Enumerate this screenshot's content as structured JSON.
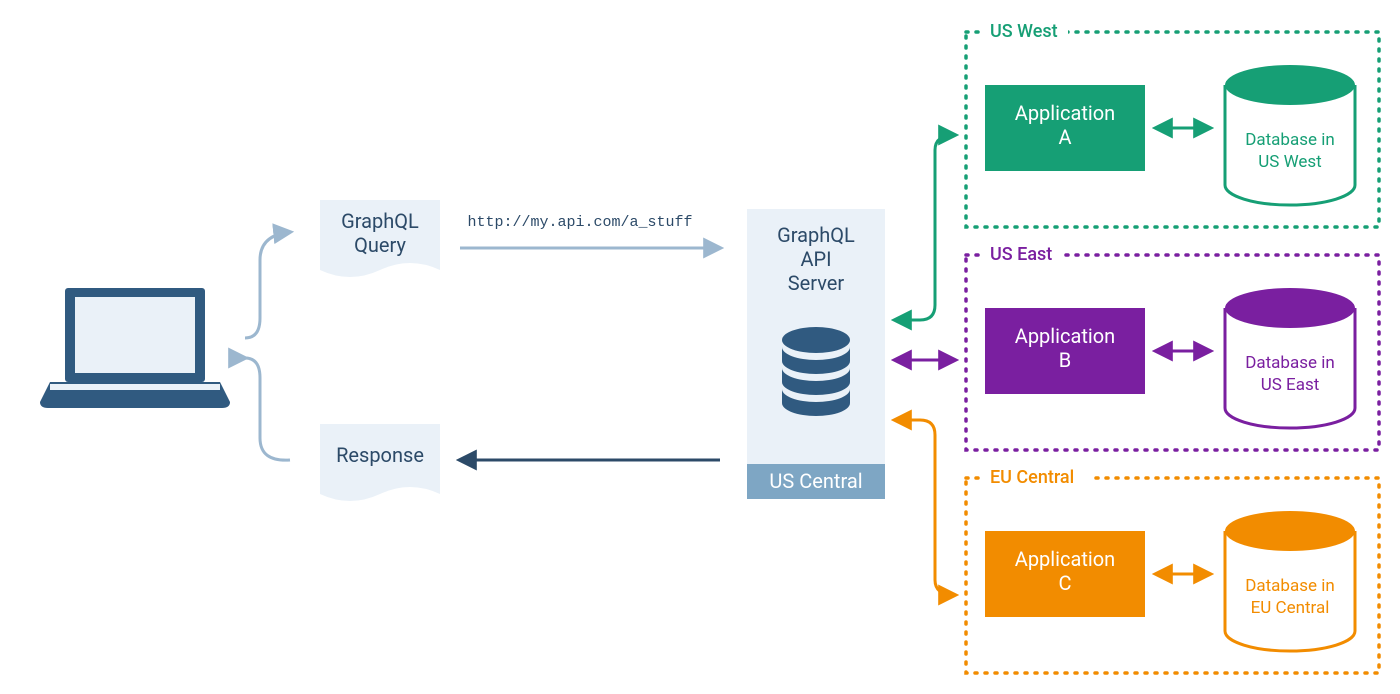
{
  "nodes": {
    "query": {
      "label1": "GraphQL",
      "label2": "Query"
    },
    "response": {
      "label": "Response"
    },
    "api_url": "http://my.api.com/a_stuff",
    "server": {
      "label1": "GraphQL",
      "label2": "API",
      "label3": "Server",
      "region": "US Central"
    }
  },
  "regions": [
    {
      "id": "us-west",
      "title": "US West",
      "color": "#169f75",
      "app": {
        "label1": "Application",
        "label2": "A"
      },
      "db": {
        "label1": "Database in",
        "label2": "US West"
      }
    },
    {
      "id": "us-east",
      "title": "US East",
      "color": "#7a1fa0",
      "app": {
        "label1": "Application",
        "label2": "B"
      },
      "db": {
        "label1": "Database in",
        "label2": "US East"
      }
    },
    {
      "id": "eu-central",
      "title": "EU Central",
      "color": "#f28c00",
      "app": {
        "label1": "Application",
        "label2": "C"
      },
      "db": {
        "label1": "Database in",
        "label2": "EU Central"
      }
    }
  ],
  "colors": {
    "pale": "#eaf1f8",
    "steel": "#305a80",
    "slate": "#2c4a68",
    "lightSteel": "#9cb7cf",
    "midBlue": "#7ea6c4"
  }
}
